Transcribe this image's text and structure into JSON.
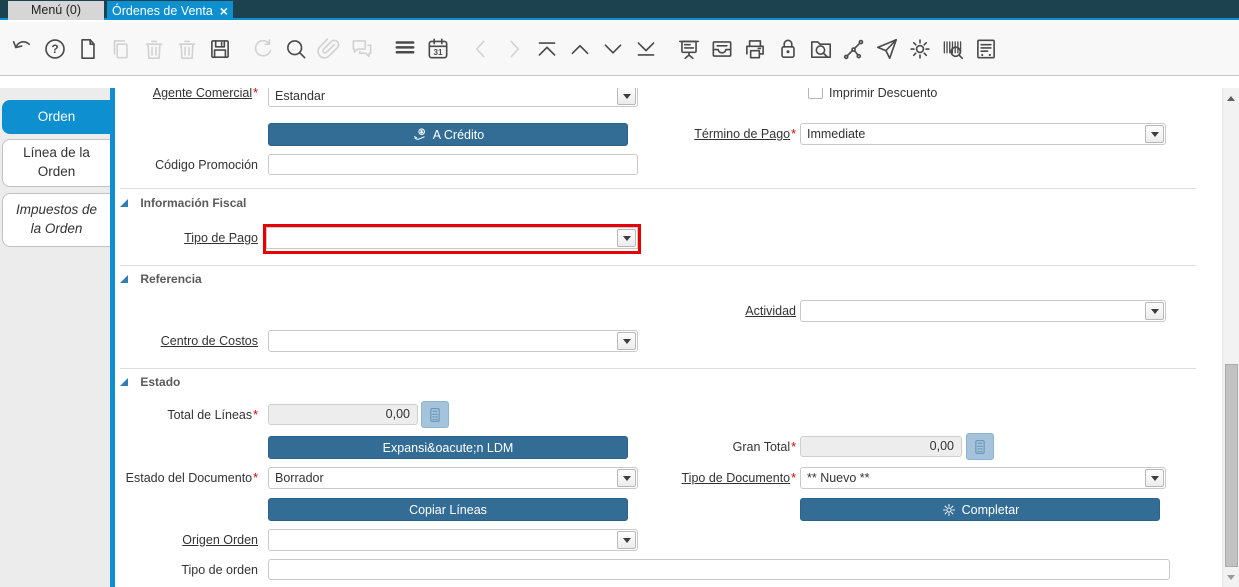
{
  "window": {
    "menu_tab_label": "Menú (0)",
    "tab_label": "Órdenes de Venta"
  },
  "toolbar": {
    "icons": [
      {
        "name": "undo",
        "enabled": true
      },
      {
        "name": "help",
        "enabled": true
      },
      {
        "name": "new-record",
        "enabled": true
      },
      {
        "name": "copy-record",
        "enabled": false
      },
      {
        "name": "delete-record",
        "enabled": false
      },
      {
        "name": "delete-selection",
        "enabled": false
      },
      {
        "name": "save",
        "enabled": true
      },
      {
        "name": "refresh",
        "enabled": false,
        "gap_before": true
      },
      {
        "name": "find",
        "enabled": true
      },
      {
        "name": "attachment",
        "enabled": false
      },
      {
        "name": "chat",
        "enabled": false
      },
      {
        "name": "grid-toggle",
        "enabled": true,
        "gap_before": true
      },
      {
        "name": "calendar",
        "enabled": true
      },
      {
        "name": "previous-record",
        "enabled": false,
        "gap_before": true
      },
      {
        "name": "next-record",
        "enabled": false
      },
      {
        "name": "first-record",
        "enabled": true
      },
      {
        "name": "parent-record",
        "enabled": true
      },
      {
        "name": "detail-record",
        "enabled": true
      },
      {
        "name": "last-record",
        "enabled": true
      },
      {
        "name": "report",
        "enabled": true,
        "gap_before": true
      },
      {
        "name": "archive",
        "enabled": true
      },
      {
        "name": "print",
        "enabled": true
      },
      {
        "name": "lock",
        "enabled": true
      },
      {
        "name": "zoom-across",
        "enabled": true
      },
      {
        "name": "workflow",
        "enabled": true
      },
      {
        "name": "send-mail",
        "enabled": true
      },
      {
        "name": "process",
        "enabled": true
      },
      {
        "name": "barcode",
        "enabled": true
      },
      {
        "name": "report-window",
        "enabled": true
      }
    ]
  },
  "sidebar": {
    "tabs": [
      {
        "label": "Orden",
        "active": true
      },
      {
        "label": "Línea de la Orden",
        "active": false
      },
      {
        "label": "Impuestos de la Orden",
        "active": false,
        "italic": true
      }
    ]
  },
  "form": {
    "sections": [
      {
        "title": "Información Fiscal"
      },
      {
        "title": "Referencia"
      },
      {
        "title": "Estado"
      }
    ],
    "fields": {
      "agente_comercial": {
        "label": "Agente Comercial",
        "value": "Estandar",
        "required": true
      },
      "imprimir_descuento": {
        "label": "Imprimir Descuento",
        "checked": false
      },
      "termino_de_pago": {
        "label": "Término de Pago",
        "value": "Immediate",
        "required": true
      },
      "codigo_promocion": {
        "label": "Código Promoción",
        "value": ""
      },
      "tipo_de_pago": {
        "label": "Tipo de Pago",
        "value": "",
        "highlighted": true
      },
      "actividad": {
        "label": "Actividad",
        "value": ""
      },
      "centro_de_costos": {
        "label": "Centro de Costos",
        "value": ""
      },
      "total_de_lineas": {
        "label": "Total de Líneas",
        "value": "0,00",
        "required": true,
        "readonly": true
      },
      "gran_total": {
        "label": "Gran Total",
        "value": "0,00",
        "required": true,
        "readonly": true
      },
      "estado_del_documento": {
        "label": "Estado del Documento",
        "value": "Borrador",
        "required": true
      },
      "tipo_de_documento": {
        "label": "Tipo de Documento",
        "value": "** Nuevo **",
        "required": true
      },
      "origen_orden": {
        "label": "Origen Orden",
        "value": ""
      },
      "tipo_de_orden": {
        "label": "Tipo de orden",
        "value": ""
      }
    },
    "buttons": {
      "a_credito": "A Crédito",
      "expansion_ldm": "Expansi&oacute;n LDM",
      "copiar_lineas": "Copiar Líneas",
      "completar": "Completar"
    }
  },
  "colors": {
    "accent_blue": "#0d8fd0",
    "topbar_background": "#1c4250",
    "button_blue": "#336d96",
    "highlight_border_red": "#e80000",
    "calculator_button": "#a5c3da"
  }
}
